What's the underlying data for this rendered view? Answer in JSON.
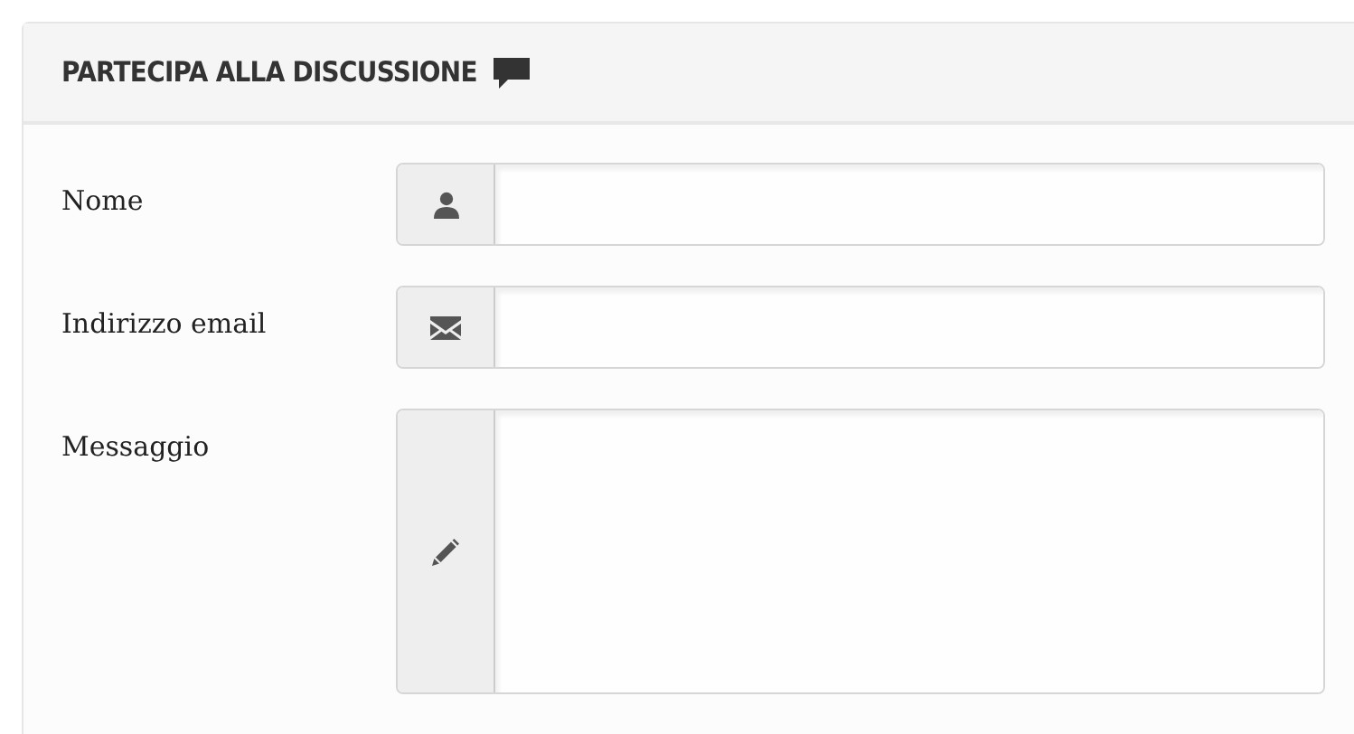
{
  "panel": {
    "title": "PARTECIPA ALLA DISCUSSIONE"
  },
  "fields": [
    {
      "kind": "name",
      "label": "Nome"
    },
    {
      "kind": "email",
      "label": "Indirizzo email"
    },
    {
      "kind": "message",
      "label": "Messaggio"
    }
  ]
}
